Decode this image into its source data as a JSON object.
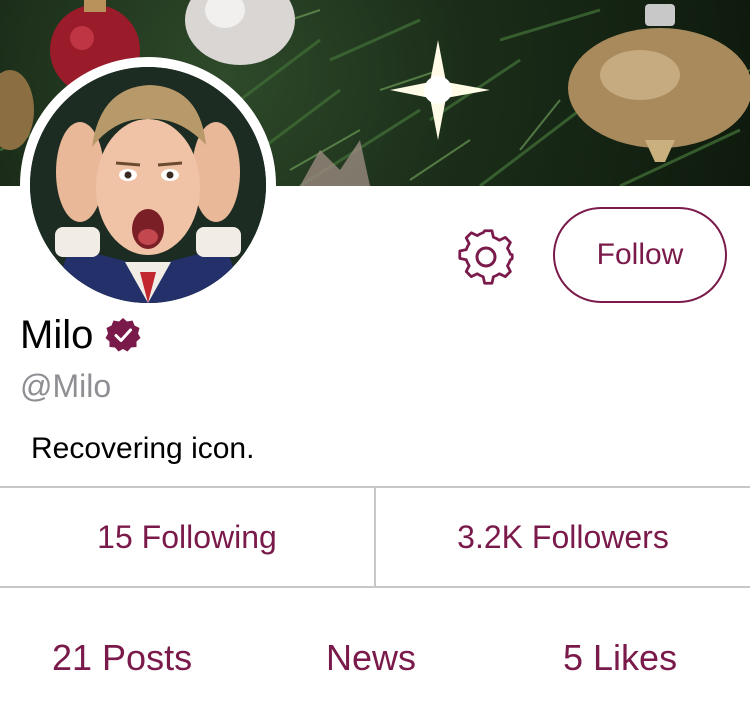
{
  "profile": {
    "display_name": "Milo",
    "handle": "@Milo",
    "bio": "Recovering icon.",
    "verified": true
  },
  "actions": {
    "follow_label": "Follow",
    "settings_icon": "gear-icon"
  },
  "stats": {
    "following_label": "15 Following",
    "followers_label": "3.2K Followers"
  },
  "tabs": [
    {
      "label": "21 Posts"
    },
    {
      "label": "News"
    },
    {
      "label": "5 Likes"
    }
  ],
  "colors": {
    "accent": "#7a1a4a",
    "handle_gray": "#8e8e93",
    "divider": "#c8c8c8"
  }
}
